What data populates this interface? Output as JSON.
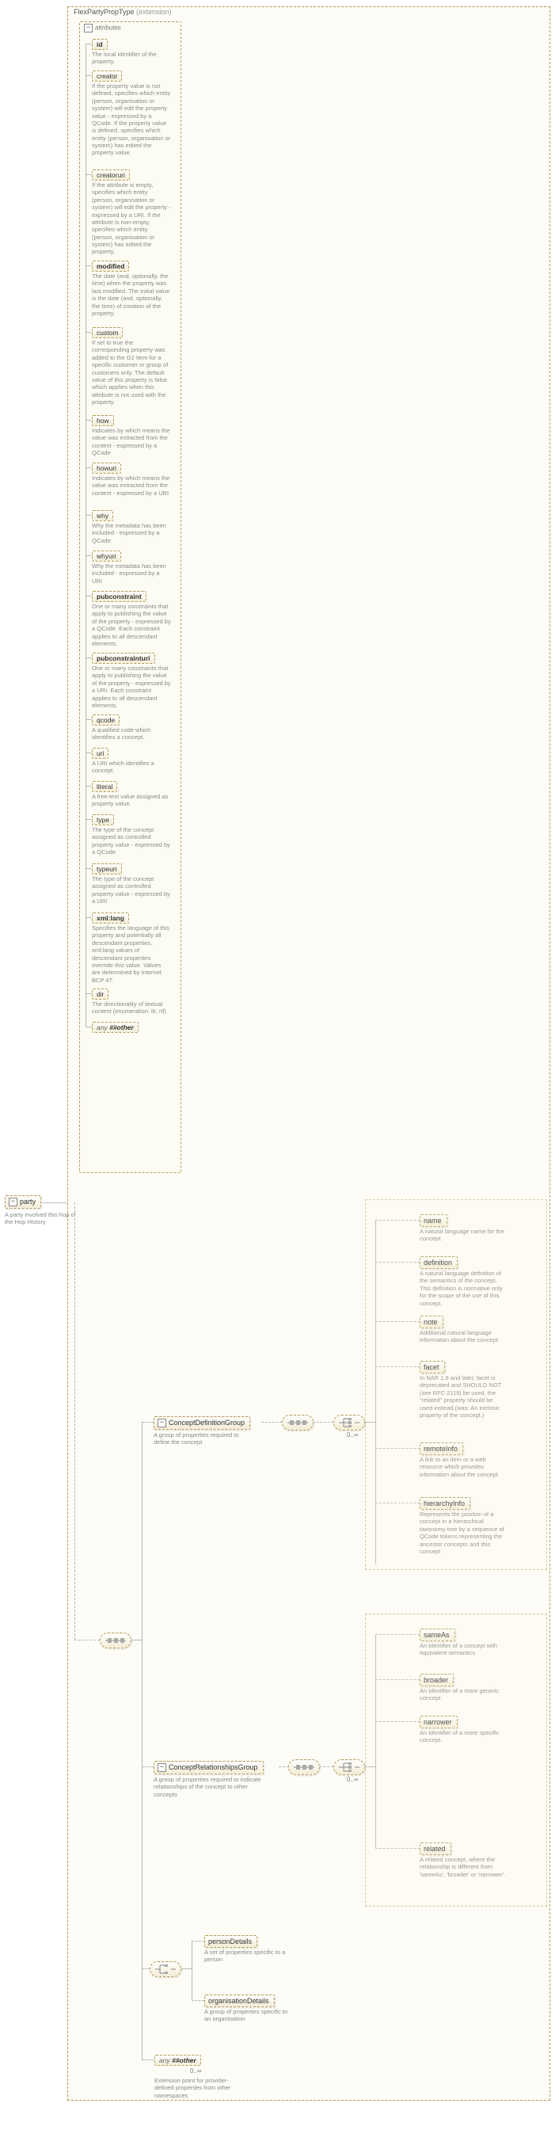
{
  "extension": {
    "title": "FlexPartyPropType",
    "tag": "(extension)"
  },
  "root": {
    "name": "party",
    "desc": "A party involved this hop of the Hop History"
  },
  "attr_label": "attributes",
  "attrs": [
    {
      "name": "id",
      "bold": true,
      "desc": "The local identifier of the property."
    },
    {
      "name": "creator",
      "desc": "If the property value is not defined, specifies which entity (person, organisation or system) will edit the property value - expressed by a QCode. If the property value is defined, specifies which entity (person, organisation or system) has edited the property value."
    },
    {
      "name": "creatoruri",
      "desc": "If the attribute is empty, specifies which entity (person, organisation or system) will edit the property - expressed by a URI. If the attribute is non-empty, specifies which entity (person, organisation or system) has edited the property."
    },
    {
      "name": "modified",
      "bold": true,
      "desc": "The date (and, optionally, the time) when the property was last modified. The initial value is the date (and, optionally, the time) of creation of the property."
    },
    {
      "name": "custom",
      "desc": "If set to true the corresponding property was added to the G2 Item for a specific customer or group of customers only. The default value of this property is false which applies when this attribute is not used with the property."
    },
    {
      "name": "how",
      "desc": "Indicates by which means the value was extracted from the content - expressed by a QCode"
    },
    {
      "name": "howuri",
      "desc": "Indicates by which means the value was extracted from the content - expressed by a URI"
    },
    {
      "name": "why",
      "desc": "Why the metadata has been included - expressed by a QCode"
    },
    {
      "name": "whyuri",
      "desc": "Why the metadata has been included - expressed by a URI"
    },
    {
      "name": "pubconstraint",
      "bold": true,
      "desc": "One or many constraints that apply to publishing the value of the property - expressed by a QCode. Each constraint applies to all descendant elements."
    },
    {
      "name": "pubconstrainturi",
      "bold": true,
      "desc": "One or many constraints that apply to publishing the value of the property - expressed by a URI. Each constraint applies to all descendant elements."
    },
    {
      "name": "qcode",
      "desc": "A qualified code which identifies a concept."
    },
    {
      "name": "uri",
      "desc": "A URI which identifies a concept."
    },
    {
      "name": "literal",
      "desc": "A free-text value assigned as property value."
    },
    {
      "name": "type",
      "desc": "The type of the concept assigned as controlled property value - expressed by a QCode"
    },
    {
      "name": "typeuri",
      "desc": "The type of the concept assigned as controlled property value - expressed by a URI"
    },
    {
      "name": "xml:lang",
      "bold": true,
      "desc": "Specifies the language of this property and potentially all descendant properties. xml:lang values of descendant properties override this value. Values are determined by Internet BCP 47."
    },
    {
      "name": "dir",
      "desc": "The directionality of textual content (enumeration: ltr, rtl)"
    }
  ],
  "any_attr": "##other",
  "groups": {
    "cdg": {
      "name": "ConceptDefinitionGroup",
      "desc": "A group of properties required to define the concept"
    },
    "crg": {
      "name": "ConceptRelationshipsGroup",
      "desc": "A group of properties required to indicate relationships of the concept to other concepts"
    }
  },
  "cdg_items": [
    {
      "name": "name",
      "desc": "A natural language name for the concept."
    },
    {
      "name": "definition",
      "desc": "A natural language definition of the semantics of the concept. This definition is normative only for the scope of the use of this concept."
    },
    {
      "name": "note",
      "desc": "Additional natural language information about the concept."
    },
    {
      "name": "facet",
      "desc": "In NAR 1.8 and later, facet is deprecated and SHOULD NOT (see RFC 2119) be used, the \"related\" property should be used instead.(was: An intrinsic property of the concept.)"
    },
    {
      "name": "remoteInfo",
      "desc": "A link to an item or a web resource which provides information about the concept"
    },
    {
      "name": "hierarchyInfo",
      "desc": "Represents the position of a concept in a hierarchical taxonomy tree by a sequence of QCode tokens representing the ancestor concepts and this concept"
    }
  ],
  "crg_items": [
    {
      "name": "sameAs",
      "desc": "An identifier of a concept with equivalent semantics"
    },
    {
      "name": "broader",
      "desc": "An identifier of a more generic concept."
    },
    {
      "name": "narrower",
      "desc": "An identifier of a more specific concept."
    },
    {
      "name": "related",
      "desc": "A related concept, where the relationship is different from 'sameAs', 'broader' or 'narrower'."
    }
  ],
  "entity_choice": [
    {
      "name": "personDetails",
      "desc": "A set of properties specific to a person"
    },
    {
      "name": "organisationDetails",
      "desc": "A group of properties specific to an organisation"
    }
  ],
  "any_elem": {
    "label": "##other",
    "card": "0..∞",
    "desc": "Extension point for provider-defined properties from other namespaces"
  },
  "cards": {
    "zero_inf": "0..∞"
  },
  "any_word": "any"
}
